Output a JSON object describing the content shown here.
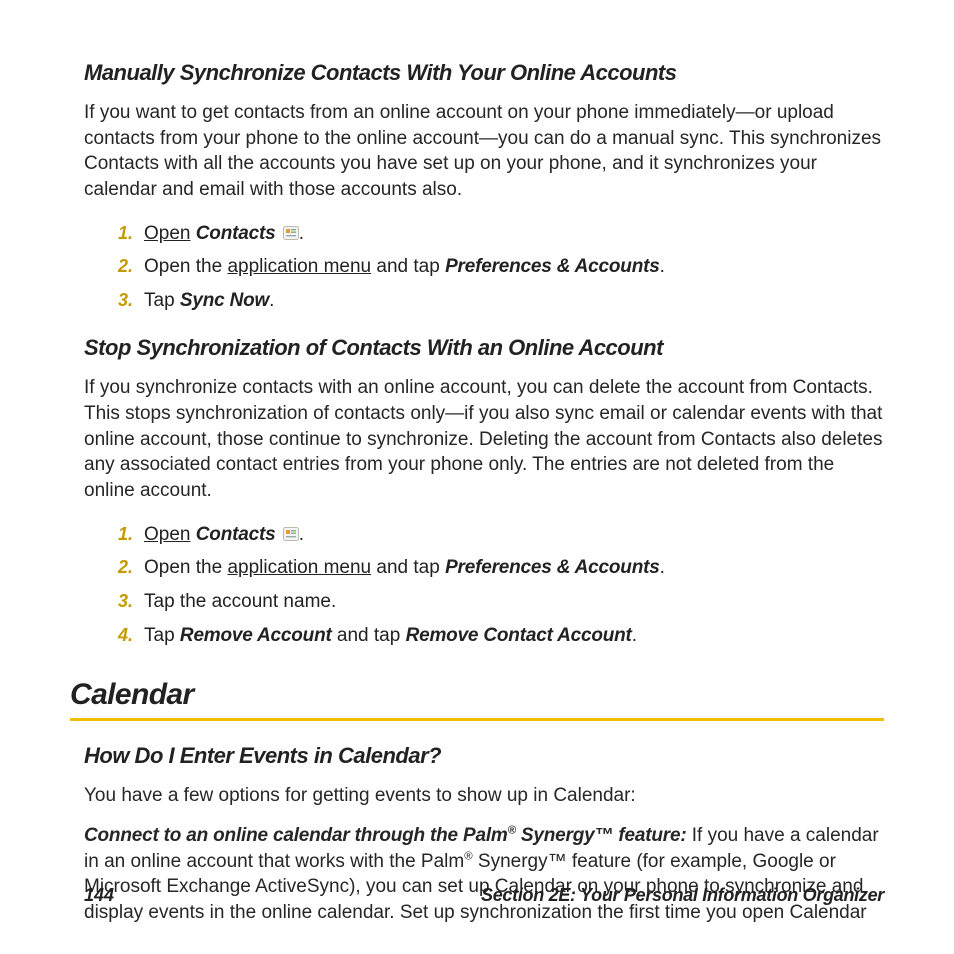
{
  "sections": {
    "sync": {
      "heading": "Manually Synchronize Contacts With Your Online Accounts",
      "para": "If you want to get contacts from an online account on your phone immediately—or upload contacts from your phone to the online account—you can do a manual sync. This synchronizes Contacts with all the accounts you have set up on your phone, and it synchronizes your calendar and email with those accounts also.",
      "step1_open": "Open",
      "step1_app": "Contacts",
      "step1_period": ".",
      "step2_pre": "Open the ",
      "step2_link": "application menu",
      "step2_mid": " and tap ",
      "step2_bold": "Preferences & Accounts",
      "step2_end": ".",
      "step3_pre": "Tap ",
      "step3_bold": "Sync Now",
      "step3_end": "."
    },
    "stop": {
      "heading": "Stop Synchronization of Contacts With an Online Account",
      "para": "If you synchronize contacts with an online account, you can delete the account from Contacts. This stops synchronization of contacts only—if you also sync email or calendar events with that online account, those continue to synchronize. Deleting the account from Contacts also deletes any associated contact entries from your phone only. The entries are not deleted from the online account.",
      "step1_open": "Open",
      "step1_app": "Contacts",
      "step1_period": ".",
      "step2_pre": "Open the ",
      "step2_link": "application menu",
      "step2_mid": " and tap ",
      "step2_bold": "Preferences & Accounts",
      "step2_end": ".",
      "step3": "Tap the account name.",
      "step4_pre": "Tap ",
      "step4_bold1": "Remove Account",
      "step4_mid": " and tap ",
      "step4_bold2": "Remove Contact Account",
      "step4_end": "."
    },
    "calendar": {
      "title": "Calendar",
      "subhead": "How Do I Enter Events in Calendar?",
      "intro": "You have a few options for getting events to show up in Calendar:",
      "lead_bold_a": "Connect to an online calendar through the Palm",
      "lead_bold_b": " Synergy™ feature:",
      "body_a": " If you have a calendar in an online account that works with the Palm",
      "body_b": " Synergy™ feature (for example, Google or Microsoft Exchange ActiveSync), you can set up Calendar on your phone to synchronize and display events in the online calendar. Set up synchronization the first time you open Calendar",
      "reg": "®"
    }
  },
  "icons": {
    "contacts": "contacts-app-icon"
  },
  "footer": {
    "page": "144",
    "label": "Section 2E: Your Personal Information Organizer"
  }
}
